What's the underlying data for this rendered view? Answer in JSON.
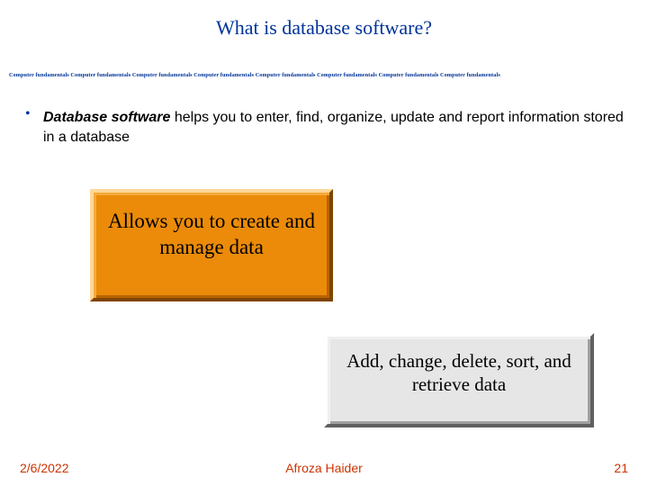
{
  "title": "What is database software?",
  "divider": "Computer fundamentals Computer fundamentals  Computer fundamentals  Computer fundamentals Computer fundamentals  Computer fundamentals  Computer fundamentals Computer fundamentals",
  "body": {
    "bullet_glyph": "•",
    "lead": "Database software",
    "rest": " helps you to enter, find, organize, update and report information stored in a database"
  },
  "callout1": "Allows you to create and manage data",
  "callout2": "Add, change, delete, sort, and retrieve data",
  "footer": {
    "date": "2/6/2022",
    "author": "Afroza Haider",
    "page": "21"
  },
  "colors": {
    "title": "#003399",
    "footer": "#cc3300",
    "callout1_bg": "#eb8b09",
    "callout2_bg": "#e6e6e6"
  }
}
